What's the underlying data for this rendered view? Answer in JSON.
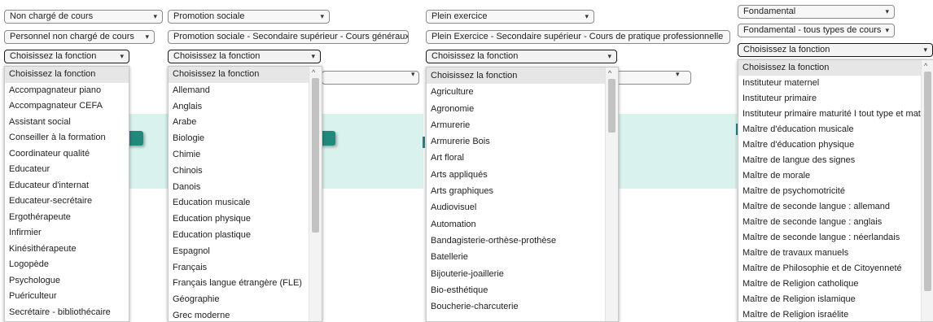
{
  "col1": {
    "select1": "Non chargé de cours",
    "select2": "Personnel non chargé de cours",
    "select3": "Choisissez la fonction",
    "options": [
      "Choisissez la fonction",
      "Accompagnateur piano",
      "Accompagnateur CEFA",
      "Assistant social",
      "Conseiller à la formation",
      "Coordinateur qualité",
      "Educateur",
      "Educateur d'internat",
      "Educateur-secrétaire",
      "Ergothérapeute",
      "Infirmier",
      "Kinésithérapeute",
      "Logopède",
      "Psychologue",
      "Puériculteur",
      "Secrétaire - bibliothécaire"
    ]
  },
  "col2": {
    "select1": "Promotion sociale",
    "select2": "Promotion sociale - Secondaire supérieur - Cours généraux",
    "select3": "Choisissez la fonction",
    "options": [
      "Choisissez la fonction",
      "Allemand",
      "Anglais",
      "Arabe",
      "Biologie",
      "Chimie",
      "Chinois",
      "Danois",
      "Education musicale",
      "Education physique",
      "Education plastique",
      "Espagnol",
      "Français",
      "Français langue étrangère (FLE)",
      "Géographie",
      "Grec moderne"
    ]
  },
  "col3": {
    "select1": "Plein exercice",
    "select2": "Plein Exercice - Secondaire supérieur - Cours de pratique professionnelle",
    "select3": "Choisissez la fonction",
    "options": [
      "Choisissez la fonction",
      "Agriculture",
      "Agronomie",
      "Armurerie",
      "Armurerie Bois",
      "Art floral",
      "Arts appliqués",
      "Arts graphiques",
      "Audiovisuel",
      "Automation",
      "Bandagisterie-orthèse-prothèse",
      "Batellerie",
      "Bijouterie-joaillerie",
      "Bio-esthétique",
      "Boucherie-charcuterie"
    ]
  },
  "col4": {
    "select1": "Fondamental",
    "select2": "Fondamental - tous types de cours",
    "select3": "Choisissez la fonction",
    "options": [
      "Choisissez la fonction",
      "Instituteur maternel",
      "Instituteur primaire",
      "Instituteur primaire maturité I tout type et matur",
      "Maître d'éducation musicale",
      "Maître d'éducation physique",
      "Maître de langue des signes",
      "Maître de morale",
      "Maître de psychomotricité",
      "Maître de seconde langue : allemand",
      "Maître de seconde langue : anglais",
      "Maître de seconde langue : néerlandais",
      "Maître de travaux manuels",
      "Maître de Philosophie et de Citoyenneté",
      "Maître de Religion catholique",
      "Maître de Religion islamique",
      "Maître de Religion israélite"
    ]
  },
  "icons": {
    "caret": "▾",
    "scroll_up": "^"
  },
  "colors": {
    "band": "#d9f2ee",
    "teal": "#21887c"
  }
}
